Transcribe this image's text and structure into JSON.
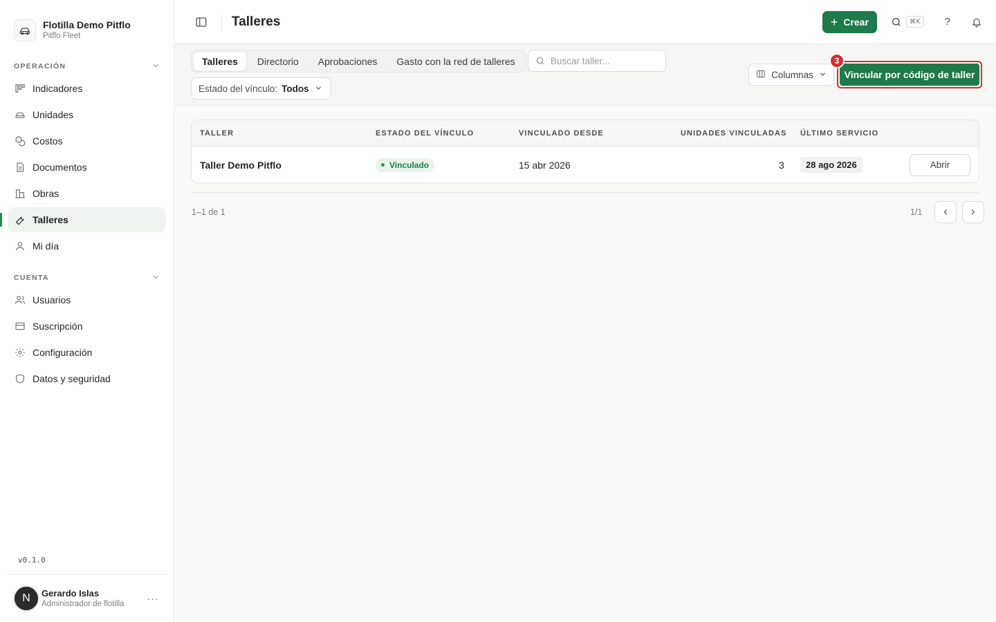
{
  "brand": {
    "name": "Flotilla Demo Pitflo",
    "subtitle": "Pitflo Fleet"
  },
  "sidebar": {
    "sections": [
      {
        "title": "OPERACIÓN",
        "items": [
          {
            "label": "Indicadores",
            "icon": "chart-bars-icon"
          },
          {
            "label": "Unidades",
            "icon": "car-icon"
          },
          {
            "label": "Costos",
            "icon": "coins-icon"
          },
          {
            "label": "Documentos",
            "icon": "document-icon"
          },
          {
            "label": "Obras",
            "icon": "building-icon"
          },
          {
            "label": "Talleres",
            "icon": "wrench-icon",
            "active": true
          },
          {
            "label": "Mi día",
            "icon": "user-icon"
          }
        ]
      },
      {
        "title": "CUENTA",
        "items": [
          {
            "label": "Usuarios",
            "icon": "users-icon"
          },
          {
            "label": "Suscripción",
            "icon": "credit-card-icon"
          },
          {
            "label": "Configuración",
            "icon": "gear-icon"
          },
          {
            "label": "Datos y seguridad",
            "icon": "shield-icon"
          }
        ]
      }
    ],
    "version": "v0.1.0",
    "user": {
      "initial": "N",
      "name": "Gerardo Islas",
      "role": "Administrador de flotilla",
      "more": "···"
    }
  },
  "topbar": {
    "title": "Talleres",
    "create_label": "Crear",
    "shortcut": "⌘K",
    "help": "?"
  },
  "toolbar": {
    "tabs": [
      "Talleres",
      "Directorio",
      "Aprobaciones",
      "Gasto con la red de talleres"
    ],
    "active_tab": 0,
    "search_placeholder": "Buscar taller...",
    "filter_label": "Estado del vínculo:",
    "filter_value": "Todos",
    "columns_label": "Columnas",
    "link_button_label": "Vincular por código de taller",
    "badge": "3"
  },
  "table": {
    "headers": [
      "TALLER",
      "ESTADO DEL VÍNCULO",
      "VINCULADO DESDE",
      "UNIDADES VINCULADAS",
      "ÚLTIMO SERVICIO"
    ],
    "rows": [
      {
        "taller": "Taller Demo Pitflo",
        "estado": "Vinculado",
        "desde": "15 abr 2026",
        "unidades": "3",
        "ultimo": "28 ago 2026",
        "action": "Abrir"
      }
    ]
  },
  "pagination": {
    "summary": "1–1 de 1",
    "page": "1/1"
  },
  "colors": {
    "accent": "#1e7a4a",
    "highlight": "#d32f2f",
    "active_bg": "#eef3ef"
  }
}
